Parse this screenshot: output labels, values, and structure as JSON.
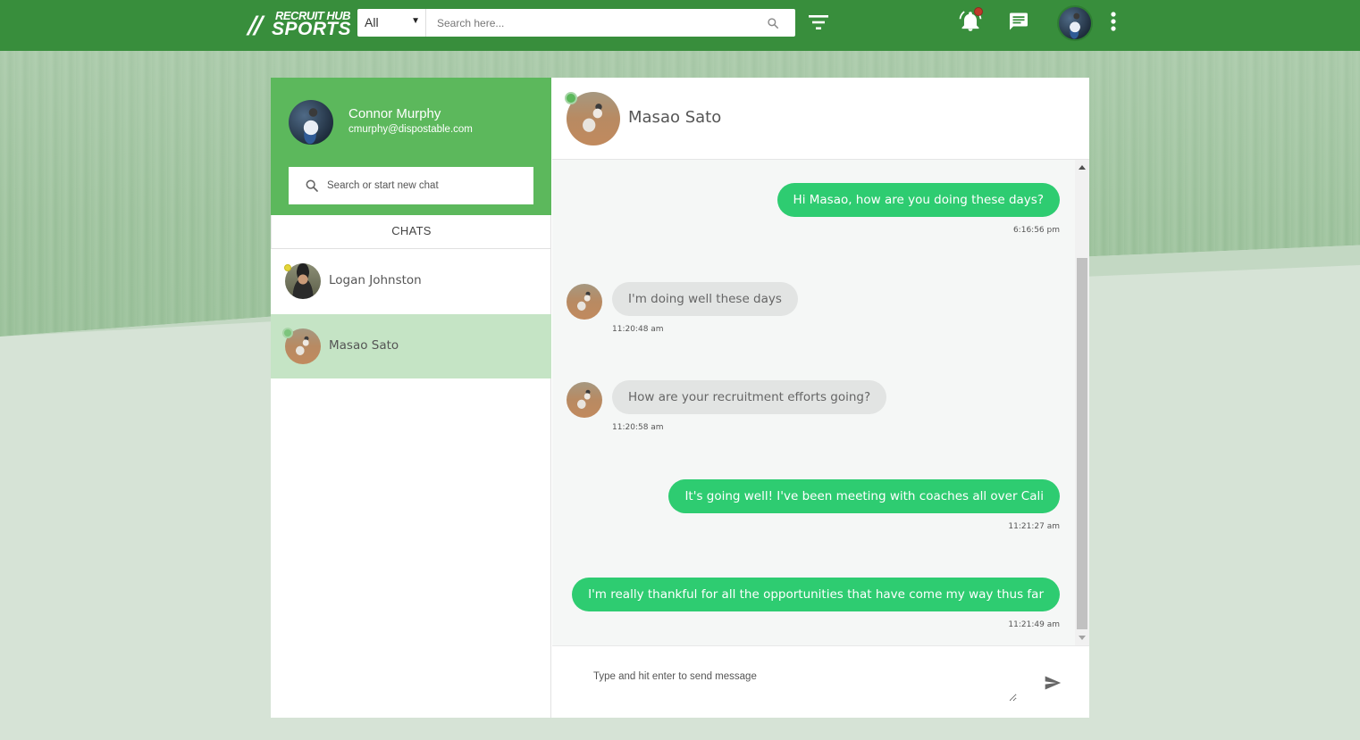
{
  "app": {
    "logo_line1": "RECRUIT HUB",
    "logo_line2": "SPORTS",
    "logo_slashes": "//"
  },
  "topbar": {
    "category": "All",
    "search_placeholder": "Search here...",
    "accent_color": "#388e3c"
  },
  "me": {
    "name": "Connor Murphy",
    "email": "cmurphy@dispostable.com"
  },
  "sidebar": {
    "search_placeholder": "Search or start new chat",
    "tab_label": "CHATS",
    "contacts": [
      {
        "name": "Logan Johnston",
        "status_color": "#e4d53a"
      },
      {
        "name": "Masao Sato",
        "status_color": "#7cc47c",
        "active": true
      }
    ]
  },
  "chat": {
    "contact_name": "Masao Sato",
    "messages": [
      {
        "direction": "out",
        "text": "Hi Masao, how are you doing these days?",
        "time": "6:16:56 pm"
      },
      {
        "direction": "in",
        "text": "I'm doing well these days",
        "time": "11:20:48 am"
      },
      {
        "direction": "in",
        "text": "How are your recruitment efforts going?",
        "time": "11:20:58 am"
      },
      {
        "direction": "out",
        "text": "It's going well! I've been meeting with coaches all over Cali",
        "time": "11:21:27 am"
      },
      {
        "direction": "out",
        "text": "I'm really thankful for all the opportunities that have come my way thus far",
        "time": "11:21:49 am"
      }
    ],
    "composer_placeholder": "Type and hit enter to send message",
    "outgoing_color": "#2ecc71",
    "incoming_color": "#e2e4e3"
  }
}
